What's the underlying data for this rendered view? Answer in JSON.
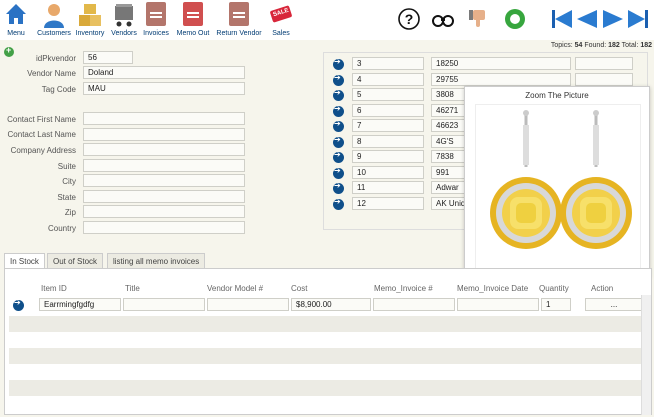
{
  "toolbar": {
    "menu": "Menu",
    "customers": "Customers",
    "inventory": "Inventory",
    "vendors": "Vendors",
    "invoices": "Invoices",
    "memo_out": "Memo Out",
    "return_vendor": "Return Vendor",
    "sales": "Sales",
    "sales_badge": "SALE"
  },
  "topics": {
    "label1": "Topics:",
    "topics": "54",
    "label2": "Found:",
    "found": "182",
    "label3": "Total:",
    "total": "182"
  },
  "form": {
    "id_label": "idPkvendor",
    "id_value": "56",
    "vendor_name_label": "Vendor Name",
    "vendor_name": "Doland",
    "tag_code_label": "Tag Code",
    "tag_code": "MAU",
    "first_name_label": "Contact First Name",
    "last_name_label": "Contact Last Name",
    "address_label": "Company Address",
    "suite_label": "Suite",
    "city_label": "City",
    "state_label": "State",
    "zip_label": "Zip",
    "country_label": "Country"
  },
  "panel": {
    "rows": [
      {
        "num": "3",
        "val": "18250"
      },
      {
        "num": "4",
        "val": "29755"
      },
      {
        "num": "5",
        "val": "3808"
      },
      {
        "num": "6",
        "val": "46271"
      },
      {
        "num": "7",
        "val": "46623"
      },
      {
        "num": "8",
        "val": "4G'S"
      },
      {
        "num": "9",
        "val": "7838"
      },
      {
        "num": "10",
        "val": "991"
      },
      {
        "num": "11",
        "val": "Adwar"
      },
      {
        "num": "12",
        "val": "AK Uniq"
      }
    ]
  },
  "zoom": {
    "title": "Zoom The Picture"
  },
  "tabs": {
    "in_stock": "In Stock",
    "out_of_stock": "Out of Stock",
    "memo": "listing all memo invoices"
  },
  "grid": {
    "headers": {
      "item_id": "Item ID",
      "title": "Title",
      "vendor_model": "Vendor Model #",
      "cost": "Cost",
      "memo_invoice": "Memo_Invoice #",
      "memo_date": "Memo_Invoice Date",
      "quantity": "Quantity",
      "action": "Action"
    },
    "row1": {
      "item_id": "Earrmingfgdfg",
      "cost": "$8,900.00",
      "qty": "1",
      "action": "..."
    }
  },
  "colors": {
    "accent": "#0f4f8a",
    "background": "#f6f5ec"
  }
}
